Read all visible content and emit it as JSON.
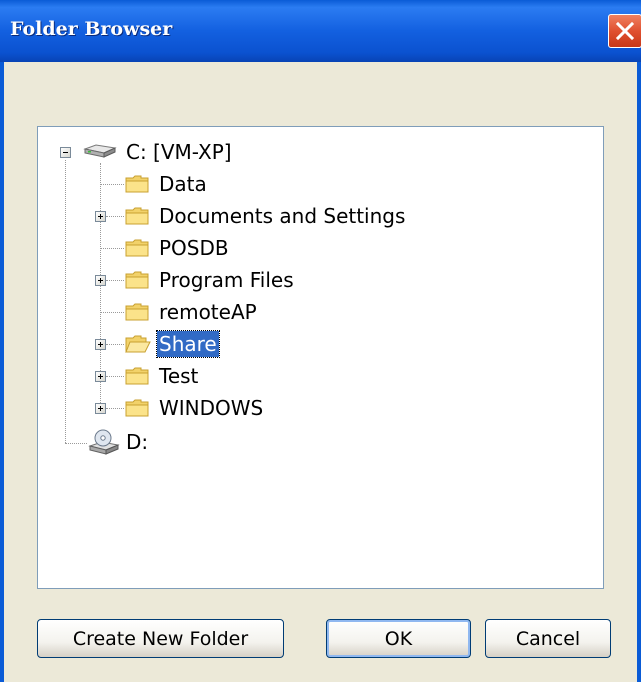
{
  "window": {
    "title": "Folder Browser",
    "close_icon": "close-icon"
  },
  "tree": {
    "nodes": [
      {
        "label": "C: [VM-XP]",
        "icon": "hard-drive-icon",
        "expander": "minus",
        "level": 0
      },
      {
        "label": "Data",
        "icon": "folder-icon",
        "expander": "none",
        "level": 1
      },
      {
        "label": "Documents and Settings",
        "icon": "folder-icon",
        "expander": "plus",
        "level": 1
      },
      {
        "label": "POSDB",
        "icon": "folder-icon",
        "expander": "none",
        "level": 1
      },
      {
        "label": "Program Files",
        "icon": "folder-icon",
        "expander": "plus",
        "level": 1
      },
      {
        "label": "remoteAP",
        "icon": "folder-icon",
        "expander": "none",
        "level": 1
      },
      {
        "label": "Share",
        "icon": "open-folder-icon",
        "expander": "plus",
        "level": 1,
        "selected": true
      },
      {
        "label": "Test",
        "icon": "folder-icon",
        "expander": "plus",
        "level": 1
      },
      {
        "label": "WINDOWS",
        "icon": "folder-icon",
        "expander": "plus",
        "level": 1
      },
      {
        "label": "D:",
        "icon": "cd-drive-icon",
        "expander": "none",
        "level": 0
      }
    ]
  },
  "buttons": {
    "create_new_folder": "Create New Folder",
    "ok": "OK",
    "cancel": "Cancel"
  },
  "colors": {
    "titlebar": "#0b52d0",
    "selection": "#316ac5",
    "dialog_bg": "#ece9d8"
  }
}
